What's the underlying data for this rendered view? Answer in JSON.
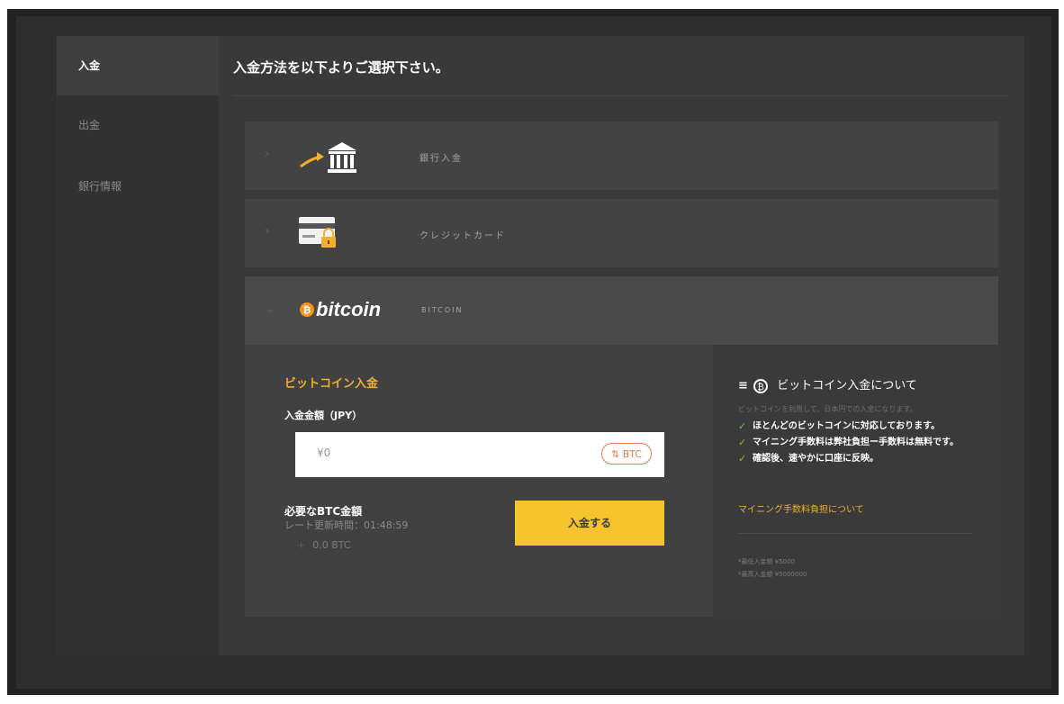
{
  "sidebar": {
    "items": [
      {
        "label": "入金",
        "active": true
      },
      {
        "label": "出金",
        "active": false
      },
      {
        "label": "銀行情報",
        "active": false
      }
    ]
  },
  "main": {
    "title": "入金方法を以下よりご選択下さい。"
  },
  "methods": {
    "bank": {
      "label": "銀行入金",
      "icon": "bank-icon"
    },
    "credit": {
      "label": "クレジットカード",
      "icon": "credit-card-icon"
    },
    "bitcoin": {
      "label": "BITCOIN",
      "logo": "bitcoin",
      "icon": "bitcoin-logo-icon"
    }
  },
  "bitcoin_form": {
    "section_title": "ビットコイン入金",
    "amount_label": "入金金額（JPY）",
    "amount_value": "¥0",
    "toggle_label": "⇅ BTC",
    "required_label": "必要なBTC金額",
    "rate_time": "レート更新時間：01:48:59",
    "btc_amount": "0.0 BTC",
    "deposit_button": "入金する"
  },
  "info": {
    "title": "ビットコイン入金について",
    "subtitle": "ビットコインを利用して、日本円での入金になります。",
    "checks": [
      "ほとんどのビットコインに対応しております。",
      "マイニング手数料は弊社負担ー手数料は無料です。",
      "確認後、速やかに口座に反映。"
    ],
    "link": "マイニング手数料負担について",
    "min": "*最低入金額 ¥5000",
    "max": "*最高入金額 ¥5000000"
  },
  "colors": {
    "accent": "#f0b12e",
    "button": "#f5c42d",
    "check": "#7cbf3a",
    "bitcoin": "#f7931a"
  }
}
